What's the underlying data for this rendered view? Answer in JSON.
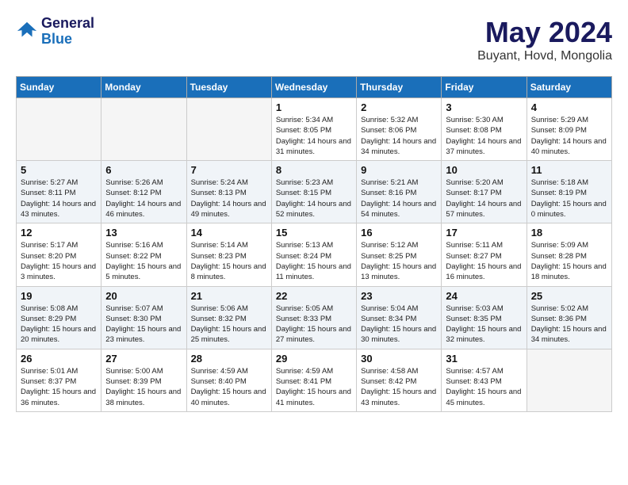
{
  "logo": {
    "line1": "General",
    "line2": "Blue"
  },
  "title": "May 2024",
  "location": "Buyant, Hovd, Mongolia",
  "weekdays": [
    "Sunday",
    "Monday",
    "Tuesday",
    "Wednesday",
    "Thursday",
    "Friday",
    "Saturday"
  ],
  "weeks": [
    [
      {
        "day": "",
        "info": ""
      },
      {
        "day": "",
        "info": ""
      },
      {
        "day": "",
        "info": ""
      },
      {
        "day": "1",
        "sunrise": "5:34 AM",
        "sunset": "8:05 PM",
        "daylight": "14 hours and 31 minutes."
      },
      {
        "day": "2",
        "sunrise": "5:32 AM",
        "sunset": "8:06 PM",
        "daylight": "14 hours and 34 minutes."
      },
      {
        "day": "3",
        "sunrise": "5:30 AM",
        "sunset": "8:08 PM",
        "daylight": "14 hours and 37 minutes."
      },
      {
        "day": "4",
        "sunrise": "5:29 AM",
        "sunset": "8:09 PM",
        "daylight": "14 hours and 40 minutes."
      }
    ],
    [
      {
        "day": "5",
        "sunrise": "5:27 AM",
        "sunset": "8:11 PM",
        "daylight": "14 hours and 43 minutes."
      },
      {
        "day": "6",
        "sunrise": "5:26 AM",
        "sunset": "8:12 PM",
        "daylight": "14 hours and 46 minutes."
      },
      {
        "day": "7",
        "sunrise": "5:24 AM",
        "sunset": "8:13 PM",
        "daylight": "14 hours and 49 minutes."
      },
      {
        "day": "8",
        "sunrise": "5:23 AM",
        "sunset": "8:15 PM",
        "daylight": "14 hours and 52 minutes."
      },
      {
        "day": "9",
        "sunrise": "5:21 AM",
        "sunset": "8:16 PM",
        "daylight": "14 hours and 54 minutes."
      },
      {
        "day": "10",
        "sunrise": "5:20 AM",
        "sunset": "8:17 PM",
        "daylight": "14 hours and 57 minutes."
      },
      {
        "day": "11",
        "sunrise": "5:18 AM",
        "sunset": "8:19 PM",
        "daylight": "15 hours and 0 minutes."
      }
    ],
    [
      {
        "day": "12",
        "sunrise": "5:17 AM",
        "sunset": "8:20 PM",
        "daylight": "15 hours and 3 minutes."
      },
      {
        "day": "13",
        "sunrise": "5:16 AM",
        "sunset": "8:22 PM",
        "daylight": "15 hours and 5 minutes."
      },
      {
        "day": "14",
        "sunrise": "5:14 AM",
        "sunset": "8:23 PM",
        "daylight": "15 hours and 8 minutes."
      },
      {
        "day": "15",
        "sunrise": "5:13 AM",
        "sunset": "8:24 PM",
        "daylight": "15 hours and 11 minutes."
      },
      {
        "day": "16",
        "sunrise": "5:12 AM",
        "sunset": "8:25 PM",
        "daylight": "15 hours and 13 minutes."
      },
      {
        "day": "17",
        "sunrise": "5:11 AM",
        "sunset": "8:27 PM",
        "daylight": "15 hours and 16 minutes."
      },
      {
        "day": "18",
        "sunrise": "5:09 AM",
        "sunset": "8:28 PM",
        "daylight": "15 hours and 18 minutes."
      }
    ],
    [
      {
        "day": "19",
        "sunrise": "5:08 AM",
        "sunset": "8:29 PM",
        "daylight": "15 hours and 20 minutes."
      },
      {
        "day": "20",
        "sunrise": "5:07 AM",
        "sunset": "8:30 PM",
        "daylight": "15 hours and 23 minutes."
      },
      {
        "day": "21",
        "sunrise": "5:06 AM",
        "sunset": "8:32 PM",
        "daylight": "15 hours and 25 minutes."
      },
      {
        "day": "22",
        "sunrise": "5:05 AM",
        "sunset": "8:33 PM",
        "daylight": "15 hours and 27 minutes."
      },
      {
        "day": "23",
        "sunrise": "5:04 AM",
        "sunset": "8:34 PM",
        "daylight": "15 hours and 30 minutes."
      },
      {
        "day": "24",
        "sunrise": "5:03 AM",
        "sunset": "8:35 PM",
        "daylight": "15 hours and 32 minutes."
      },
      {
        "day": "25",
        "sunrise": "5:02 AM",
        "sunset": "8:36 PM",
        "daylight": "15 hours and 34 minutes."
      }
    ],
    [
      {
        "day": "26",
        "sunrise": "5:01 AM",
        "sunset": "8:37 PM",
        "daylight": "15 hours and 36 minutes."
      },
      {
        "day": "27",
        "sunrise": "5:00 AM",
        "sunset": "8:39 PM",
        "daylight": "15 hours and 38 minutes."
      },
      {
        "day": "28",
        "sunrise": "4:59 AM",
        "sunset": "8:40 PM",
        "daylight": "15 hours and 40 minutes."
      },
      {
        "day": "29",
        "sunrise": "4:59 AM",
        "sunset": "8:41 PM",
        "daylight": "15 hours and 41 minutes."
      },
      {
        "day": "30",
        "sunrise": "4:58 AM",
        "sunset": "8:42 PM",
        "daylight": "15 hours and 43 minutes."
      },
      {
        "day": "31",
        "sunrise": "4:57 AM",
        "sunset": "8:43 PM",
        "daylight": "15 hours and 45 minutes."
      },
      {
        "day": "",
        "info": ""
      }
    ]
  ],
  "labels": {
    "sunrise_prefix": "Sunrise: ",
    "sunset_prefix": "Sunset: ",
    "daylight_prefix": "Daylight: "
  }
}
